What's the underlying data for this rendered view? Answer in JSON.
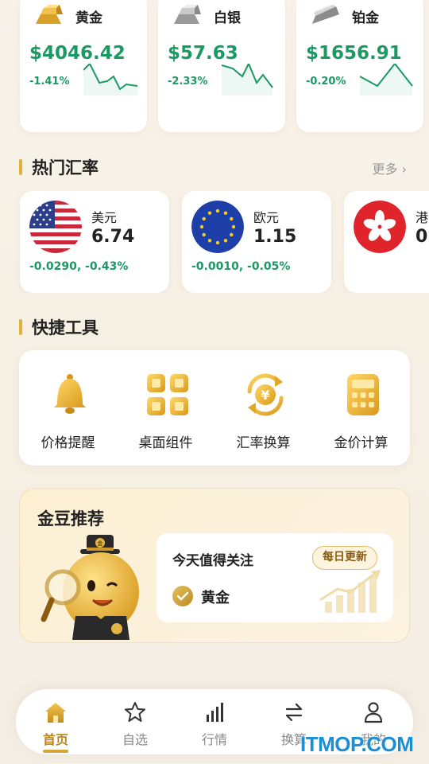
{
  "metals": [
    {
      "name": "黄金",
      "price": "$4046.42",
      "change": "-1.41%",
      "icon": "gold-bar-icon"
    },
    {
      "name": "白银",
      "price": "$57.63",
      "change": "-2.33%",
      "icon": "silver-bar-icon"
    },
    {
      "name": "铂金",
      "price": "$1656.91",
      "change": "-0.20%",
      "icon": "platinum-bar-icon"
    }
  ],
  "fx_section": {
    "title": "热门汇率",
    "more": "更多 ›"
  },
  "fx": [
    {
      "name": "美元",
      "value": "6.74",
      "change": "-0.0290, -0.43%",
      "flag": "us-flag-icon"
    },
    {
      "name": "欧元",
      "value": "1.15",
      "change": "-0.0010, -0.05%",
      "flag": "eu-flag-icon"
    },
    {
      "name": "港",
      "value": "0.",
      "change": "",
      "flag": "hk-flag-icon"
    }
  ],
  "tools_section": {
    "title": "快捷工具"
  },
  "tools": [
    {
      "label": "价格提醒",
      "icon": "bell-icon"
    },
    {
      "label": "桌面组件",
      "icon": "widgets-grid-icon"
    },
    {
      "label": "汇率换算",
      "icon": "yen-exchange-icon"
    },
    {
      "label": "金价计算",
      "icon": "calculator-icon"
    }
  ],
  "recommend": {
    "title": "金豆推荐",
    "headline": "今天值得关注",
    "badge": "每日更新",
    "item": "黄金",
    "mascot_badge": "金"
  },
  "nav": [
    {
      "label": "首页",
      "icon": "home-icon",
      "active": true
    },
    {
      "label": "自选",
      "icon": "star-icon",
      "active": false
    },
    {
      "label": "行情",
      "icon": "chart-bars-icon",
      "active": false
    },
    {
      "label": "换算",
      "icon": "swap-icon",
      "active": false
    },
    {
      "label": "我的",
      "icon": "user-icon",
      "active": false
    }
  ],
  "watermark": "ITMOP.COM",
  "colors": {
    "up_down_green": "#1a9a63",
    "accent_gold": "#e2b13c",
    "active_nav": "#b8861c"
  }
}
